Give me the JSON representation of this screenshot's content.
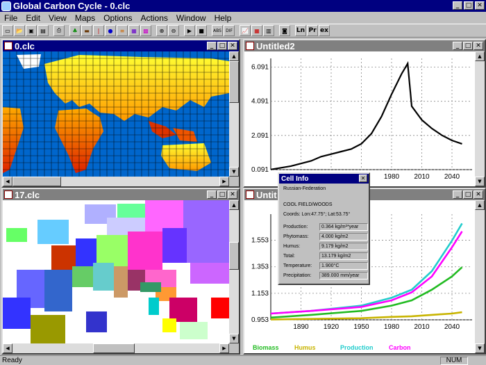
{
  "app": {
    "title": "Global Carbon Cycle - 0.clc"
  },
  "menu": [
    "File",
    "Edit",
    "View",
    "Maps",
    "Options",
    "Actions",
    "Window",
    "Help"
  ],
  "toolbar": {
    "labels": [
      "ABS",
      "DIF",
      "Ln",
      "Pr",
      "ex"
    ]
  },
  "windows": {
    "map1": {
      "title": "0.clc"
    },
    "map2": {
      "title": "17.clc"
    },
    "chart1": {
      "title": "Untitled2"
    },
    "chart2": {
      "title": "Untit"
    }
  },
  "status": {
    "ready": "Ready",
    "num": "NUM"
  },
  "cellinfo": {
    "title": "Cell Info",
    "region": "Russian-Federation",
    "biome": "COOL FIELD/WOODS",
    "coords": "Coords: Lon:47.75°; Lat:53.75°",
    "rows": [
      {
        "label": "Production:",
        "value": "0.364 kg/m²*year"
      },
      {
        "label": "Phytomass:",
        "value": "4.000 kg/m2"
      },
      {
        "label": "Humus:",
        "value": "9.179 kg/m2"
      },
      {
        "label": "Total:",
        "value": "13.179 kg/m2"
      },
      {
        "label": "Temperature:",
        "value": "1.900°C"
      },
      {
        "label": "Precipitation:",
        "value": "389.000 mm/year"
      }
    ]
  },
  "chart_data": [
    {
      "type": "line",
      "ylim": [
        0.091,
        6.6
      ],
      "xlim": [
        1860,
        2060
      ],
      "yticks": [
        "0.091",
        "2.091",
        "4.091",
        "6.091"
      ],
      "xticks": [
        "1890",
        "1920",
        "1950",
        "1980",
        "2010",
        "2040"
      ],
      "series": [
        {
          "color": "#000000",
          "x": [
            1860,
            1880,
            1900,
            1910,
            1920,
            1930,
            1940,
            1950,
            1960,
            1970,
            1980,
            1990,
            1993,
            1996,
            2000,
            2010,
            2020,
            2030,
            2040,
            2050
          ],
          "y": [
            0.1,
            0.3,
            0.6,
            0.85,
            1.0,
            1.15,
            1.3,
            1.6,
            2.2,
            3.2,
            4.5,
            5.7,
            6.0,
            6.3,
            3.8,
            3.0,
            2.5,
            2.1,
            1.8,
            1.6
          ]
        }
      ]
    },
    {
      "type": "line",
      "ylim": [
        0.953,
        1.75
      ],
      "xlim": [
        1860,
        2060
      ],
      "yticks": [
        "0.953",
        "1.153",
        "1.353",
        "1.553"
      ],
      "xticks": [
        "1890",
        "1920",
        "1950",
        "1980",
        "2010",
        "2040"
      ],
      "series": [
        {
          "name": "Biomass",
          "color": "#22bb22",
          "x": [
            1860,
            1900,
            1950,
            1980,
            2000,
            2020,
            2040,
            2050
          ],
          "y": [
            0.97,
            0.99,
            1.02,
            1.06,
            1.1,
            1.18,
            1.28,
            1.35
          ]
        },
        {
          "name": "Humus",
          "color": "#c8b400",
          "x": [
            1860,
            1900,
            1950,
            1980,
            2000,
            2020,
            2040,
            2050
          ],
          "y": [
            0.955,
            0.96,
            0.965,
            0.975,
            0.98,
            0.99,
            1.0,
            1.01
          ]
        },
        {
          "name": "Production",
          "color": "#22cccc",
          "x": [
            1860,
            1900,
            1950,
            1980,
            2000,
            2020,
            2040,
            2050
          ],
          "y": [
            1.0,
            1.02,
            1.06,
            1.12,
            1.18,
            1.32,
            1.55,
            1.68
          ]
        },
        {
          "name": "Carbon",
          "color": "#ff00ff",
          "x": [
            1860,
            1900,
            1950,
            1980,
            2000,
            2020,
            2040,
            2050
          ],
          "y": [
            1.0,
            1.02,
            1.05,
            1.1,
            1.16,
            1.28,
            1.5,
            1.62
          ]
        }
      ]
    }
  ]
}
